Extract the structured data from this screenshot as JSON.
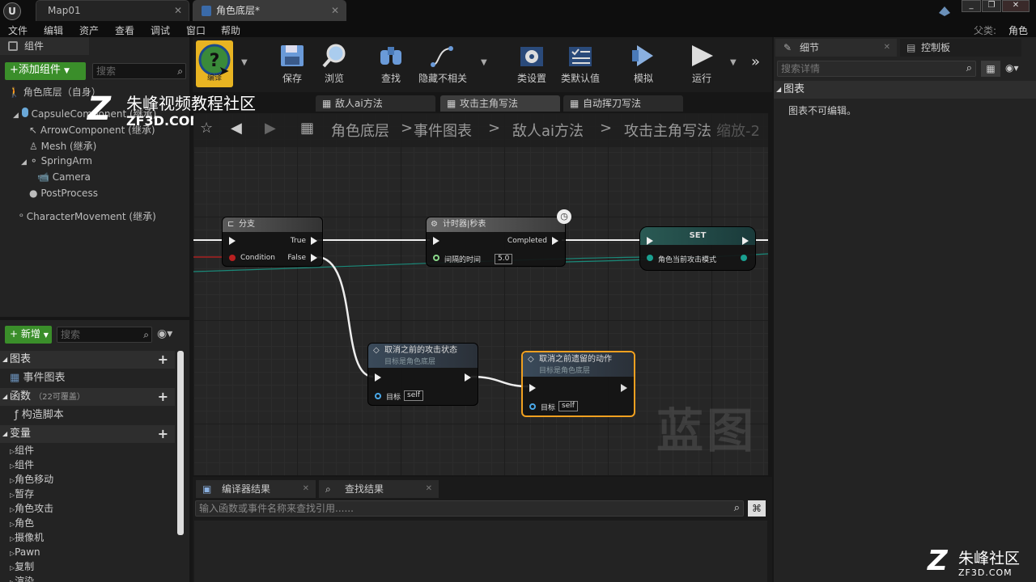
{
  "titlebar": {
    "tabs": [
      "Map01",
      "角色底层*"
    ],
    "window_buttons": [
      "_",
      "❐",
      "✕"
    ]
  },
  "menu": [
    "文件",
    "编辑",
    "资产",
    "查看",
    "调试",
    "窗口",
    "帮助"
  ],
  "parent": {
    "label": "父类:",
    "value": "角色"
  },
  "components": {
    "tab": "组件",
    "add_button": "+添加组件",
    "search_placeholder": "搜索",
    "root": "角色底层（自身）",
    "items": [
      "CapsuleComponent (继承)",
      "ArrowComponent (继承)",
      "Mesh (继承)",
      "SpringArm",
      "Camera",
      "PostProcess",
      "CharacterMovement (继承)"
    ]
  },
  "watermark": {
    "title": "朱峰视频教程社区",
    "url": "ZF3D.COM",
    "corner_title": "朱峰社区",
    "corner_url": "ZF3D.COM"
  },
  "mybp": {
    "new_button": "新增",
    "search_placeholder": "搜索",
    "graphs_label": "图表",
    "event_graph": "事件图表",
    "functions_label": "函数",
    "functions_count": "（22可覆盖）",
    "construction": "构造脚本",
    "variables_label": "变量",
    "variables": [
      "组件",
      "组件",
      "角色移动",
      "暂存",
      "角色攻击",
      "角色",
      "摄像机",
      "Pawn",
      "复制",
      "渲染"
    ]
  },
  "toolbar": {
    "compile": "编译",
    "buttons": [
      "保存",
      "浏览",
      "查找",
      "隐藏不相关",
      "类设置",
      "类默认值",
      "模拟",
      "运行"
    ]
  },
  "graph_tabs": [
    "敌人ai方法",
    "攻击主角写法",
    "自动挥刀写法"
  ],
  "breadcrumb": [
    "角色底层",
    "事件图表",
    "敌人ai方法",
    "攻击主角写法"
  ],
  "zoom": "缩放-2",
  "graph_watermark": "蓝图",
  "nodes": {
    "branch": {
      "title": "分支",
      "true_label": "True",
      "false_label": "False",
      "condition": "Condition"
    },
    "timer": {
      "title": "计时器|秒表",
      "completed": "Completed",
      "time_label": "间隔的时间",
      "time_value": "5.0"
    },
    "set": {
      "title": "SET",
      "var": "角色当前攻击模式"
    },
    "cancel_attack": {
      "title": "取消之前的攻击状态",
      "subtitle": "目标是角色底层",
      "target": "目标",
      "target_value": "self"
    },
    "cancel_action": {
      "title": "取消之前遗留的动作",
      "subtitle": "目标是角色底层",
      "target": "目标",
      "target_value": "self"
    }
  },
  "log": {
    "tabs": [
      "编译器结果",
      "查找结果"
    ],
    "search_placeholder": "输入函数或事件名称来查找引用......"
  },
  "details": {
    "tabs": [
      "细节",
      "控制板"
    ],
    "search_placeholder": "搜索详情",
    "section": "图表",
    "message": "图表不可编辑。"
  }
}
